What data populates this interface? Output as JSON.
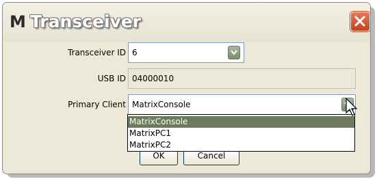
{
  "window": {
    "logo_letter": "M",
    "title": "Transceiver",
    "close_icon": "close-icon",
    "close_color": "#d2552e"
  },
  "form": {
    "transceiver_id_label": "Transceiver ID",
    "transceiver_id_value": "6",
    "usb_id_label": "USB ID",
    "usb_id_value": "04000010",
    "primary_client_label": "Primary Client",
    "primary_client_value": "MatrixConsole"
  },
  "dropdown": {
    "options": [
      "MatrixConsole",
      "MatrixPC1",
      "MatrixPC2"
    ],
    "selected_index": 0,
    "highlight_color": "#6d7a5e"
  },
  "buttons": {
    "ok": "OK",
    "cancel": "Cancel"
  }
}
